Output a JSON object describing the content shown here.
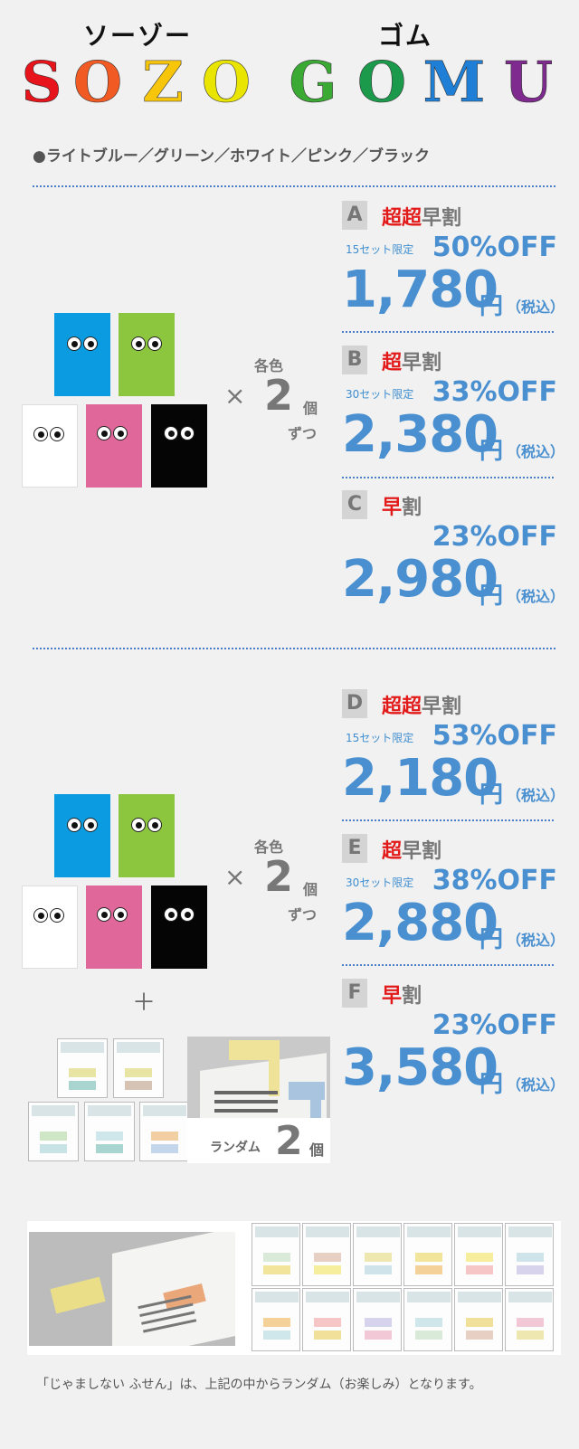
{
  "header": {
    "kana_left": "ソーゾー",
    "kana_right": "ゴム",
    "logo_letters": [
      {
        "ch": "S",
        "color": "#e8141b"
      },
      {
        "ch": "O",
        "color": "#f15a22"
      },
      {
        "ch": "Z",
        "color": "#f7c60a"
      },
      {
        "ch": "O",
        "color": "#e9e400"
      },
      {
        "ch": "G",
        "color": "#3aaa35"
      },
      {
        "ch": "O",
        "color": "#1c9a4b"
      },
      {
        "ch": "M",
        "color": "#1f7fd6"
      },
      {
        "ch": "U",
        "color": "#7e2a8e"
      }
    ]
  },
  "colors_line": "●ライトブルー／グリーン／ホワイト／ピンク／ブラック",
  "set1": {
    "each": "各色",
    "count": "2",
    "unit": "個",
    "zutsu": "ずつ",
    "times": "×"
  },
  "set2": {
    "each": "各色",
    "count": "2",
    "unit": "個",
    "zutsu": "ずつ",
    "times": "×",
    "plus": "＋",
    "random_label": "ランダム",
    "random_count": "2",
    "random_unit": "個"
  },
  "gum_colors": {
    "blue": "#0a9be0",
    "green": "#8cc63f",
    "white": "#ffffff",
    "pink": "#e0679a",
    "black": "#050505"
  },
  "plans": [
    {
      "letter": "A",
      "red": "超超",
      "rest": "早割",
      "limit": "15セット限定",
      "off": "50%OFF",
      "price": "1,780",
      "yen": "円",
      "tax": "（税込）"
    },
    {
      "letter": "B",
      "red": "超",
      "rest": "早割",
      "limit": "30セット限定",
      "off": "33%OFF",
      "price": "2,380",
      "yen": "円",
      "tax": "（税込）"
    },
    {
      "letter": "C",
      "red": "早",
      "rest": "割",
      "limit": "",
      "off": "23%OFF",
      "price": "2,980",
      "yen": "円",
      "tax": "（税込）"
    },
    {
      "letter": "D",
      "red": "超超",
      "rest": "早割",
      "limit": "15セット限定",
      "off": "53%OFF",
      "price": "2,180",
      "yen": "円",
      "tax": "（税込）"
    },
    {
      "letter": "E",
      "red": "超",
      "rest": "早割",
      "limit": "30セット限定",
      "off": "38%OFF",
      "price": "2,880",
      "yen": "円",
      "tax": "（税込）"
    },
    {
      "letter": "F",
      "red": "早",
      "rest": "割",
      "limit": "",
      "off": "23%OFF",
      "price": "3,580",
      "yen": "円",
      "tax": "（税込）"
    }
  ],
  "footer": "「じゃましない ふせん」は、上記の中からランダム（お楽しみ）となります。"
}
